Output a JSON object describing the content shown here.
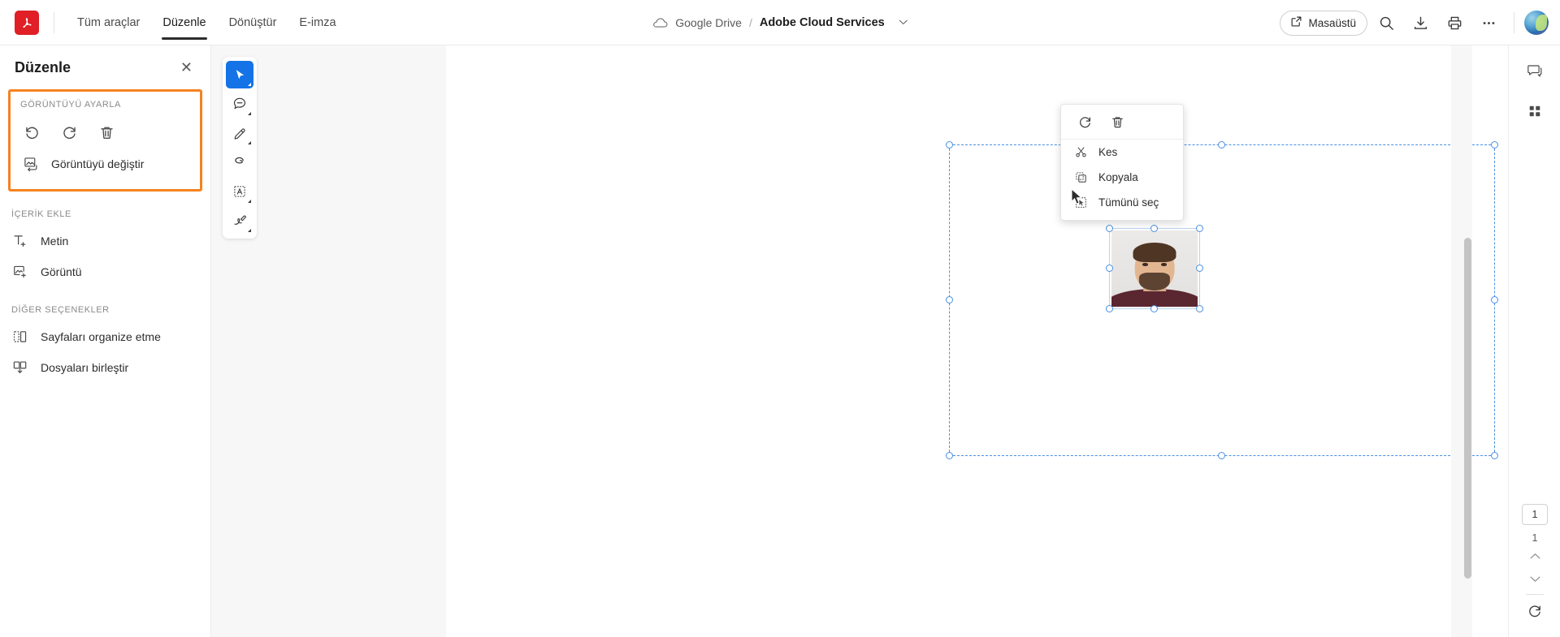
{
  "topbar": {
    "logo_text": "A",
    "logo_name": "adobe-acrobat-logo",
    "tabs": [
      {
        "label": "Tüm araçlar",
        "active": false
      },
      {
        "label": "Düzenle",
        "active": true
      },
      {
        "label": "Dönüştür",
        "active": false
      },
      {
        "label": "E-imza",
        "active": false
      }
    ],
    "breadcrumb": {
      "cloud_label": "Google Drive",
      "separator": "/",
      "document_name": "Adobe Cloud Services"
    },
    "desktop_button": "Masaüstü",
    "icons": [
      "search-icon",
      "download-icon",
      "print-icon",
      "more-options-icon"
    ]
  },
  "left_panel": {
    "title": "Düzenle",
    "close_label": "✕",
    "adjust_section": {
      "label": "GÖRÜNTÜYÜ AYARLA",
      "buttons": [
        {
          "name": "rotate-left-button",
          "label": "Sola döndür"
        },
        {
          "name": "rotate-right-button",
          "label": "Sağa döndür"
        },
        {
          "name": "delete-button",
          "label": "Sil"
        }
      ],
      "replace_image_label": "Görüntüyü değiştir",
      "highlight_color": "#f58220"
    },
    "add_content": {
      "label": "İÇERİK EKLE",
      "items": [
        {
          "label": "Metin",
          "icon": "add-text-icon"
        },
        {
          "label": "Görüntü",
          "icon": "add-image-icon"
        }
      ]
    },
    "other_options": {
      "label": "DİĞER SEÇENEKLER",
      "items": [
        {
          "label": "Sayfaları organize etme",
          "icon": "organize-pages-icon"
        },
        {
          "label": "Dosyaları birleştir",
          "icon": "combine-files-icon"
        }
      ]
    }
  },
  "toolbar": {
    "tools": [
      {
        "name": "select-tool",
        "label": "Seç",
        "active": true
      },
      {
        "name": "comment-tool",
        "label": "Yorum",
        "active": false
      },
      {
        "name": "highlight-tool",
        "label": "Vurgula",
        "active": false
      },
      {
        "name": "draw-tool",
        "label": "Çiz",
        "active": false
      },
      {
        "name": "add-text-box-tool",
        "label": "Metin kutusu",
        "active": false
      },
      {
        "name": "signature-tool",
        "label": "İmza",
        "active": false
      }
    ]
  },
  "context_menu": {
    "icon_buttons": [
      {
        "name": "rotate-right-button",
        "label": "Döndür"
      },
      {
        "name": "delete-button",
        "label": "Sil"
      }
    ],
    "items": [
      {
        "label": "Kes",
        "icon": "cut-icon"
      },
      {
        "label": "Kopyala",
        "icon": "copy-icon"
      },
      {
        "label": "Tümünü seç",
        "icon": "select-all-icon"
      }
    ]
  },
  "right_rail": {
    "buttons": [
      {
        "name": "comments-panel-button",
        "label": "Yorumlar"
      },
      {
        "name": "all-tools-grid-button",
        "label": "Tüm araçlar"
      }
    ],
    "page_current": "1",
    "page_total": "1",
    "rotate_label": "Döndür"
  },
  "colors": {
    "accent_blue": "#1473e6",
    "selection_blue": "#4a90e2",
    "highlight_orange": "#f58220",
    "brand_red": "#e01f26"
  }
}
